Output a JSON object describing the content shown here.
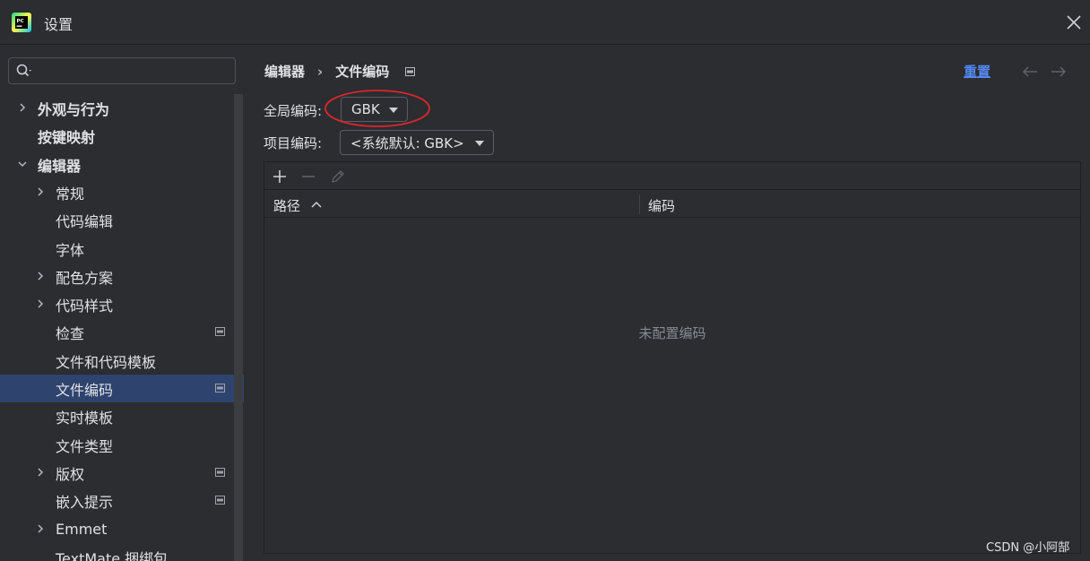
{
  "window": {
    "title": "设置"
  },
  "search": {
    "value": "",
    "placeholder": ""
  },
  "sidebar": {
    "items": [
      {
        "label": "外观与行为",
        "expandable": true,
        "expanded": false,
        "bold": true,
        "indent": 0
      },
      {
        "label": "按键映射",
        "expandable": false,
        "bold": true,
        "indent": 0
      },
      {
        "label": "编辑器",
        "expandable": true,
        "expanded": true,
        "bold": true,
        "indent": 0
      },
      {
        "label": "常规",
        "expandable": true,
        "expanded": false,
        "indent": 1
      },
      {
        "label": "代码编辑",
        "expandable": false,
        "indent": 1
      },
      {
        "label": "字体",
        "expandable": false,
        "indent": 1
      },
      {
        "label": "配色方案",
        "expandable": true,
        "expanded": false,
        "indent": 1
      },
      {
        "label": "代码样式",
        "expandable": true,
        "expanded": false,
        "indent": 1
      },
      {
        "label": "检查",
        "expandable": false,
        "indent": 1,
        "pinned": true
      },
      {
        "label": "文件和代码模板",
        "expandable": false,
        "indent": 1
      },
      {
        "label": "文件编码",
        "expandable": false,
        "indent": 1,
        "pinned": true,
        "selected": true
      },
      {
        "label": "实时模板",
        "expandable": false,
        "indent": 1
      },
      {
        "label": "文件类型",
        "expandable": false,
        "indent": 1
      },
      {
        "label": "版权",
        "expandable": true,
        "expanded": false,
        "indent": 1,
        "pinned": true
      },
      {
        "label": "嵌入提示",
        "expandable": false,
        "indent": 1,
        "pinned": true
      },
      {
        "label": "Emmet",
        "expandable": true,
        "expanded": false,
        "indent": 1
      },
      {
        "label": "TextMate 捆绑包",
        "expandable": false,
        "indent": 1
      }
    ]
  },
  "main": {
    "breadcrumb": [
      "编辑器",
      "文件编码"
    ],
    "breadcrumb_separator": "›",
    "reset_label": "重置",
    "global_encoding": {
      "label": "全局编码:",
      "value": "GBK"
    },
    "project_encoding": {
      "label": "项目编码:",
      "value": "<系统默认: GBK>"
    },
    "table": {
      "columns": [
        "路径",
        "编码"
      ],
      "rows": [],
      "empty_text": "未配置编码"
    }
  },
  "watermark": "CSDN @小阿郜",
  "colors": {
    "background": "#2b2d30",
    "selection": "#2e436e",
    "link": "#548af7",
    "annotation_ellipse": "#d9262c"
  },
  "icons": {
    "app": "pycharm-logo",
    "close": "close-icon",
    "search": "search-icon",
    "add": "add-icon",
    "remove": "remove-icon",
    "edit": "edit-icon",
    "back": "arrow-left-icon",
    "forward": "arrow-right-icon",
    "sort": "sort-ascending-icon",
    "pin": "project-level-icon"
  }
}
